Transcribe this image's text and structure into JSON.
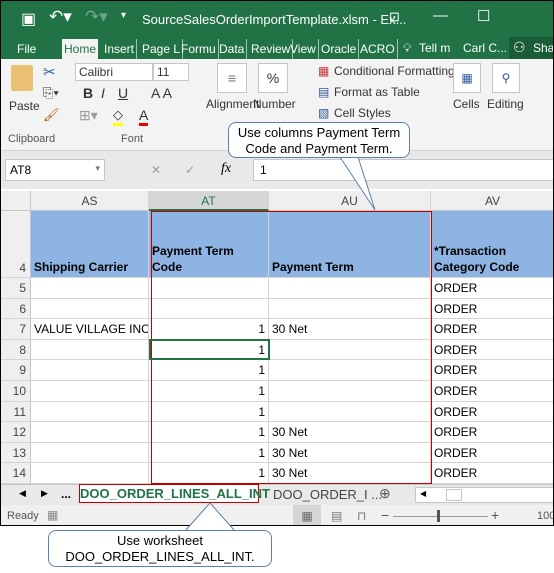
{
  "title_bar": {
    "filename": "SourceSalesOrderImportTemplate.xlsm - Ex..."
  },
  "ribbon_tabs": [
    "File",
    "Home",
    "Insert",
    "Page L",
    "Formu",
    "Data",
    "Review",
    "View",
    "Oracle",
    "ACRO"
  ],
  "tell_me": "Tell m",
  "user": "Carl C...",
  "share": "Sha",
  "ribbon": {
    "paste": "Paste",
    "clipboard": "Clipboard",
    "font_name": "Calibri",
    "font_size": "11",
    "font": "Font",
    "alignment": "Alignment",
    "number": "Number",
    "conditional": "Conditional Formatting",
    "format_table": "Format as Table",
    "cell_styles": "Cell Styles",
    "cells": "Cells",
    "editing": "Editing",
    "bold": "B",
    "italic": "I",
    "underline": "U",
    "percent": "%"
  },
  "formula_bar": {
    "name_box": "AT8",
    "fx": "fx",
    "value": "1"
  },
  "columns": [
    "AS",
    "AT",
    "AU",
    "AV"
  ],
  "header_row": {
    "num": "4",
    "cells": [
      "Shipping Carrier",
      "Payment Term Code",
      "Payment Term",
      "*Transaction Category Code"
    ]
  },
  "rows": [
    {
      "num": "5",
      "cells": [
        "",
        "",
        "",
        "ORDER"
      ]
    },
    {
      "num": "6",
      "cells": [
        "",
        "",
        "",
        "ORDER"
      ]
    },
    {
      "num": "7",
      "cells": [
        "VALUE VILLAGE INC",
        "1",
        "30 Net",
        "ORDER"
      ]
    },
    {
      "num": "8",
      "cells": [
        "",
        "1",
        "",
        "ORDER"
      ]
    },
    {
      "num": "9",
      "cells": [
        "",
        "1",
        "",
        "ORDER"
      ]
    },
    {
      "num": "10",
      "cells": [
        "",
        "1",
        "",
        "ORDER"
      ]
    },
    {
      "num": "11",
      "cells": [
        "",
        "1",
        "",
        "ORDER"
      ]
    },
    {
      "num": "12",
      "cells": [
        "",
        "1",
        "30 Net",
        "ORDER"
      ]
    },
    {
      "num": "13",
      "cells": [
        "",
        "1",
        "30 Net",
        "ORDER"
      ]
    },
    {
      "num": "14",
      "cells": [
        "",
        "1",
        "30 Net",
        "ORDER"
      ]
    }
  ],
  "sheet_tabs": {
    "ellipsis": "...",
    "active": "DOO_ORDER_LINES_ALL_INT",
    "other": "DOO_ORDER_I ..."
  },
  "status": {
    "ready": "Ready",
    "zoom": "100"
  },
  "callouts": {
    "columns": "Use columns Payment Term Code and Payment Term.",
    "worksheet_line1": "Use worksheet",
    "worksheet_line2": "DOO_ORDER_LINES_ALL_INT."
  },
  "colors": {
    "excel_green": "#217346",
    "header_fill": "#8db4e2",
    "highlight_red": "#c00000"
  }
}
